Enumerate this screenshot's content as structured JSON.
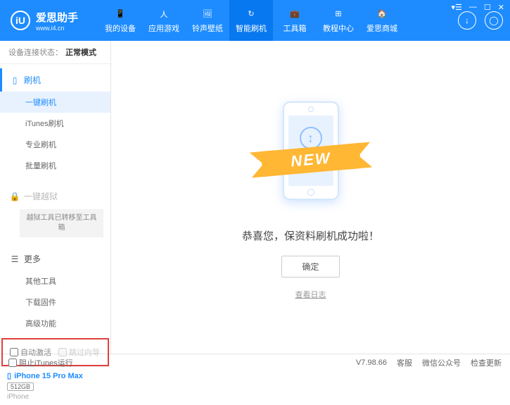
{
  "logo": {
    "icon": "iU",
    "title": "爱思助手",
    "subtitle": "www.i4.cn"
  },
  "nav": [
    {
      "label": "我的设备"
    },
    {
      "label": "应用游戏"
    },
    {
      "label": "铃声壁纸"
    },
    {
      "label": "智能刷机",
      "active": true
    },
    {
      "label": "工具箱"
    },
    {
      "label": "教程中心"
    },
    {
      "label": "爱思商城"
    }
  ],
  "status": {
    "label": "设备连接状态：",
    "value": "正常模式"
  },
  "sidebar": {
    "flash_header": "刷机",
    "flash_items": [
      {
        "label": "一键刷机",
        "active": true
      },
      {
        "label": "iTunes刷机"
      },
      {
        "label": "专业刷机"
      },
      {
        "label": "批量刷机"
      }
    ],
    "jailbreak_header": "一键越狱",
    "jailbreak_note": "越狱工具已转移至工具箱",
    "more_header": "更多",
    "more_items": [
      {
        "label": "其他工具"
      },
      {
        "label": "下载固件"
      },
      {
        "label": "高级功能"
      }
    ],
    "checkboxes": {
      "auto_activate": "自动激活",
      "skip_guide": "跳过向导"
    }
  },
  "device": {
    "name": "iPhone 15 Pro Max",
    "storage": "512GB",
    "type": "iPhone"
  },
  "main": {
    "ribbon": "NEW",
    "success": "恭喜您，保资料刷机成功啦！",
    "ok": "确定",
    "log": "查看日志"
  },
  "footer": {
    "block_itunes": "阻止iTunes运行",
    "version": "V7.98.66",
    "links": [
      "客服",
      "微信公众号",
      "检查更新"
    ]
  }
}
